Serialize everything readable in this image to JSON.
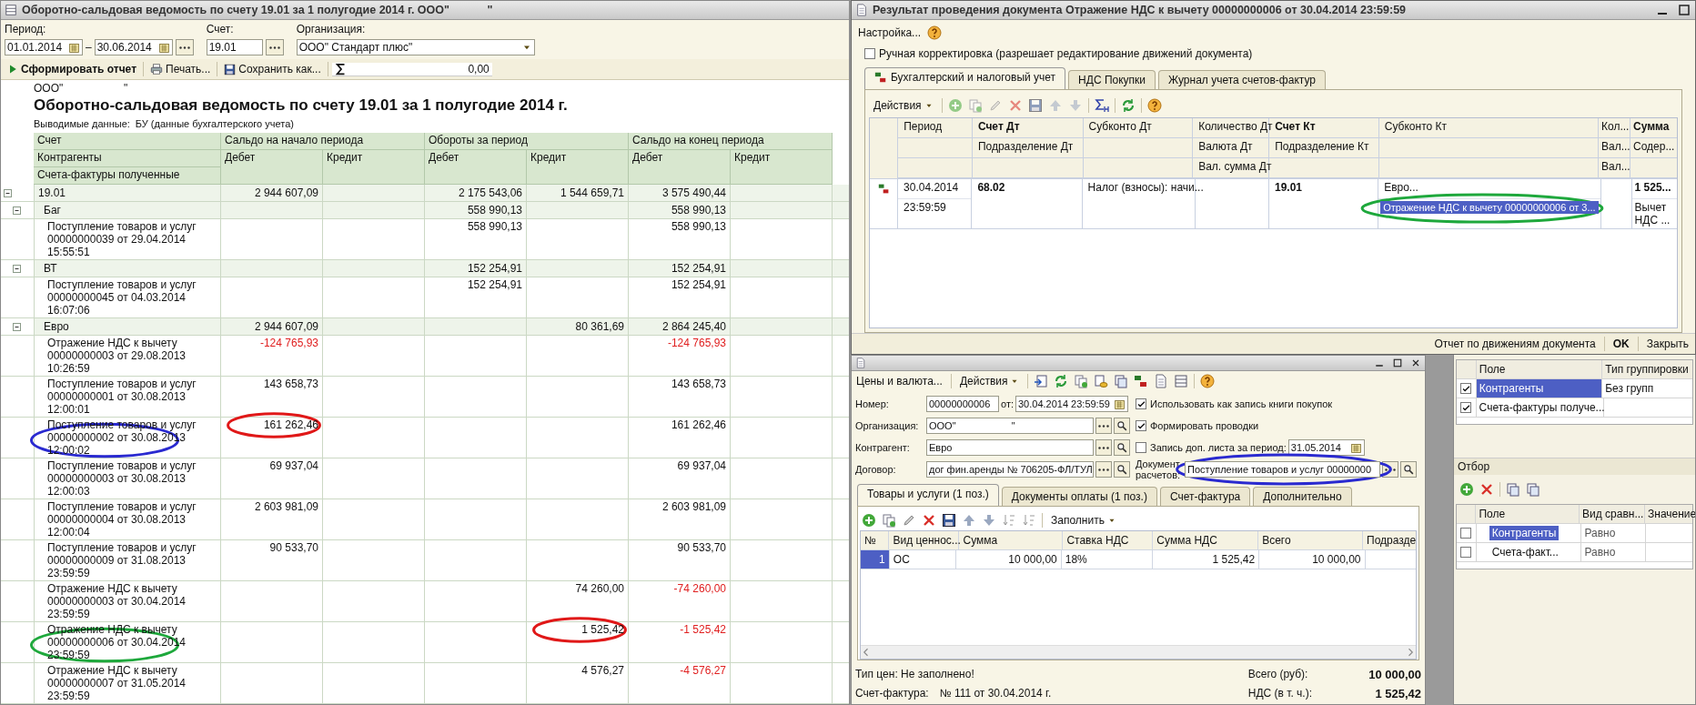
{
  "report_window": {
    "title": "Оборотно-сальдовая ведомость по счету 19.01 за 1 полугодие 2014 г. ООО\"            \"",
    "filters": {
      "period_label": "Период:",
      "date_from": "01.01.2014",
      "dash": "–",
      "date_to": "30.06.2014",
      "account_label": "Счет:",
      "account": "19.01",
      "org_label": "Организация:",
      "org": "ООО\" Стандарт плюс\""
    },
    "toolbar": {
      "generate": "Сформировать отчет",
      "print": "Печать...",
      "save": "Сохранить как...",
      "sum": "0,00"
    },
    "org_line": "ООО\"                    \"",
    "heading": "Оборотно-сальдовая ведомость по счету 19.01 за 1 полугодие 2014 г.",
    "output_label": "Выводимые данные:",
    "output_value": "БУ (данные бухгалтерского учета)",
    "header": {
      "row_labels": [
        "Счет",
        "Контрагенты",
        "Счета-фактуры полученные"
      ],
      "groups": [
        "Сальдо на начало периода",
        "Обороты за период",
        "Сальдо на конец периода"
      ],
      "sides": [
        "Дебет",
        "Кредит",
        "Дебет",
        "Кредит",
        "Дебет",
        "Кредит"
      ]
    },
    "rows": [
      {
        "label": "19.01",
        "expanded": true,
        "cells": {
          "start_debit": {
            "text": "2 944 607,09",
            "negative": false
          },
          "turnover_debit": {
            "text": "2 175 543,06",
            "negative": false
          },
          "turnover_credit": {
            "text": "1 544 659,71",
            "negative": false
          },
          "end_debit": {
            "text": "3 575 490,44",
            "negative": false
          }
        },
        "children": [
          {
            "label": "Баг",
            "expanded": true,
            "cells": {
              "turnover_debit": {
                "text": "558 990,13",
                "negative": false
              },
              "end_debit": {
                "text": "558 990,13",
                "negative": false
              }
            },
            "children": [
              {
                "label": "Поступление товаров и услуг 00000000039 от 29.04.2014 15:55:51",
                "cells": {
                  "turnover_debit": {
                    "text": "558 990,13",
                    "negative": false
                  },
                  "end_debit": {
                    "text": "558 990,13",
                    "negative": false
                  }
                }
              }
            ]
          },
          {
            "label": "ВТ",
            "expanded": true,
            "cells": {
              "turnover_debit": {
                "text": "152 254,91",
                "negative": false
              },
              "end_debit": {
                "text": "152 254,91",
                "negative": false
              }
            },
            "children": [
              {
                "label": "Поступление товаров и услуг 00000000045 от 04.03.2014 16:07:06",
                "cells": {
                  "turnover_debit": {
                    "text": "152 254,91",
                    "negative": false
                  },
                  "end_debit": {
                    "text": "152 254,91",
                    "negative": false
                  }
                }
              }
            ]
          },
          {
            "label": "Евро",
            "expanded": true,
            "cells": {
              "start_debit": {
                "text": "2 944 607,09",
                "negative": false
              },
              "turnover_credit": {
                "text": "80 361,69",
                "negative": false
              },
              "end_debit": {
                "text": "2 864 245,40",
                "negative": false
              }
            },
            "children": [
              {
                "label": "Отражение НДС к вычету 00000000003 от 29.08.2013 10:26:59",
                "cells": {
                  "start_debit": {
                    "text": "-124 765,93",
                    "negative": true
                  },
                  "end_debit": {
                    "text": "-124 765,93",
                    "negative": true
                  }
                }
              },
              {
                "label": "Поступление товаров и услуг 00000000001 от 30.08.2013 12:00:01",
                "cells": {
                  "start_debit": {
                    "text": "143 658,73",
                    "negative": false
                  },
                  "end_debit": {
                    "text": "143 658,73",
                    "negative": false
                  }
                }
              },
              {
                "label": "Поступление товаров и услуг 00000000002 от 30.08.2013 12:00:02",
                "label_circle": {
                  "color": "#2a2ad0"
                },
                "cells": {
                  "start_debit": {
                    "text": "161 262,46",
                    "negative": false,
                    "circle": {
                      "color": "#e01818"
                    }
                  },
                  "end_debit": {
                    "text": "161 262,46",
                    "negative": false
                  }
                }
              },
              {
                "label": "Поступление товаров и услуг 00000000003 от 30.08.2013 12:00:03",
                "cells": {
                  "start_debit": {
                    "text": "69 937,04",
                    "negative": false
                  },
                  "end_debit": {
                    "text": "69 937,04",
                    "negative": false
                  }
                }
              },
              {
                "label": "Поступление товаров и услуг 00000000004 от 30.08.2013 12:00:04",
                "cells": {
                  "start_debit": {
                    "text": "2 603 981,09",
                    "negative": false
                  },
                  "end_debit": {
                    "text": "2 603 981,09",
                    "negative": false
                  }
                }
              },
              {
                "label": "Поступление товаров и услуг 00000000009 от 31.08.2013 23:59:59",
                "cells": {
                  "start_debit": {
                    "text": "90 533,70",
                    "negative": false
                  },
                  "end_debit": {
                    "text": "90 533,70",
                    "negative": false
                  }
                }
              },
              {
                "label": "Отражение НДС к вычету 00000000003 от 30.04.2014 23:59:59",
                "cells": {
                  "turnover_credit": {
                    "text": "74 260,00",
                    "negative": false
                  },
                  "end_debit": {
                    "text": "-74 260,00",
                    "negative": true
                  }
                }
              },
              {
                "label": "Отражение НДС к вычету 00000000006 от 30.04.2014 23:59:59",
                "label_circle": {
                  "color": "#1ea83c"
                },
                "cells": {
                  "turnover_credit": {
                    "text": "1 525,42",
                    "negative": false,
                    "circle": {
                      "color": "#e01818"
                    }
                  },
                  "end_debit": {
                    "text": "-1 525,42",
                    "negative": true
                  }
                }
              },
              {
                "label": "Отражение НДС к вычету 00000000007 от 31.05.2014 23:59:59",
                "cells": {
                  "turnover_credit": {
                    "text": "4 576,27",
                    "negative": false
                  },
                  "end_debit": {
                    "text": "-4 576,27",
                    "negative": true
                  }
                }
              }
            ]
          }
        ]
      }
    ]
  },
  "result_dialog": {
    "title": "Результат проведения документа Отражение НДС к вычету 00000000006 от 30.04.2014 23:59:59",
    "settings_menu": "Настройка...",
    "manual_edit": {
      "label": "Ручная корректировка (разрешает редактирование движений документа)",
      "checked": false
    },
    "tabs": [
      {
        "label": "Бухгалтерский и налоговый учет",
        "selected": true,
        "kind": "ledger"
      },
      {
        "label": "НДС Покупки",
        "selected": false,
        "kind": "plain"
      },
      {
        "label": "Журнал учета счетов-фактур",
        "selected": false,
        "kind": "plain"
      }
    ],
    "actions": "Действия",
    "columns": [
      {
        "lines": [
          "Период"
        ],
        "bold": false
      },
      {
        "lines": [
          "Счет Дт",
          "Подразделение Дт"
        ],
        "bold": true
      },
      {
        "lines": [
          "Субконто Дт"
        ],
        "bold": false
      },
      {
        "lines": [
          "Количество Дт",
          "Валюта Дт",
          "Вал. сумма Дт"
        ],
        "bold": false
      },
      {
        "lines": [
          "Счет Кт",
          "Подразделение Кт"
        ],
        "bold": true
      },
      {
        "lines": [
          "Субконто Кт"
        ],
        "bold": false
      },
      {
        "lines": [
          "Кол...",
          "Вал...",
          "Вал..."
        ],
        "bold": false
      },
      {
        "lines": [
          "Сумма",
          "Содер..."
        ],
        "bold": true
      }
    ],
    "entries": [
      {
        "cells": [
          {
            "lines": [
              "30.04.2014",
              "23:59:59"
            ],
            "bold": false
          },
          {
            "lines": [
              "68.02"
            ],
            "bold": true
          },
          {
            "lines": [
              "Налог (взносы): начи..."
            ],
            "bold": false
          },
          null,
          {
            "lines": [
              "19.01"
            ],
            "bold": true
          },
          {
            "lines": [
              "Евро..."
            ],
            "bold": false,
            "highlight": {
              "text": "Отражение НДС к вычету 00000000006 от 3...",
              "selected": true,
              "circle": {
                "color": "#1ea83c"
              }
            }
          },
          null,
          {
            "lines": [
              "1 525...",
              "Вычет НДС ..."
            ],
            "bold": true
          }
        ]
      }
    ],
    "footer": {
      "report_link": "Отчет по движениям документа",
      "ok": "OK",
      "close": "Закрыть"
    }
  },
  "document_window": {
    "toolbar": {
      "prices": "Цены и валюта...",
      "actions": "Действия"
    },
    "number_label": "Номер:",
    "number": "00000000006",
    "date_label": "от:",
    "date": "30.04.2014 23:59:59",
    "fields": [
      {
        "label": "Организация:",
        "value": "ООО\"                    \""
      },
      {
        "label": "Контрагент:",
        "value": "Евро"
      },
      {
        "label": "Договор:",
        "value": "дог фин.аренды № 706205-ФЛ/ТУЛ"
      }
    ],
    "options": [
      {
        "label": "Использовать как запись книги покупок",
        "checked": true
      },
      {
        "label": "Формировать проводки",
        "checked": true
      },
      {
        "label": "Запись доп. листа за период:",
        "checked": false,
        "value": "31.05.2014"
      }
    ],
    "settlement": {
      "label": "Документ расчетов:",
      "value": "Поступление товаров и услуг 00000000",
      "circle": {
        "color": "#2a2ad0"
      }
    },
    "tabs": [
      {
        "label": "Товары и услуги (1 поз.)",
        "selected": true
      },
      {
        "label": "Документы оплаты (1 поз.)",
        "selected": false
      },
      {
        "label": "Счет-фактура",
        "selected": false
      },
      {
        "label": "Дополнительно",
        "selected": false
      }
    ],
    "fill_button": "Заполнить",
    "table": {
      "columns": [
        "№",
        "Вид ценнос...",
        "Сумма",
        "Ставка НДС",
        "Сумма НДС",
        "Всего",
        "Подразде"
      ],
      "rows": [
        {
          "cells": [
            "1",
            "ОС",
            "10 000,00",
            "18%",
            "1 525,42",
            "10 000,00"
          ],
          "selected": true
        }
      ]
    },
    "price_type": "Тип цен: Не заполнено!",
    "total_label": "Всего (руб):",
    "total": "10 000,00",
    "invoice_label": "Счет-фактура:",
    "invoice": "№ 111 от 30.04.2014 г.",
    "vat_label": "НДС (в т. ч.):",
    "vat": "1 525,42"
  },
  "settings_panel": {
    "grouping": {
      "columns": [
        "Поле",
        "Тип группировки"
      ],
      "rows": [
        {
          "field": "Контрагенты",
          "type": "Без групп",
          "checked": true,
          "selected": true
        },
        {
          "field": "Счета-фактуры получе...",
          "checked": true,
          "selected": false
        }
      ]
    },
    "filter": {
      "title": "Отбор",
      "columns": [
        "Поле",
        "Вид сравн...",
        "Значение"
      ],
      "rows": [
        {
          "field": "Контрагенты",
          "comparison": "Равно",
          "checked": false,
          "selected": true
        },
        {
          "field": "Счета-факт...",
          "comparison": "Равно",
          "checked": false,
          "selected": false
        }
      ]
    }
  }
}
